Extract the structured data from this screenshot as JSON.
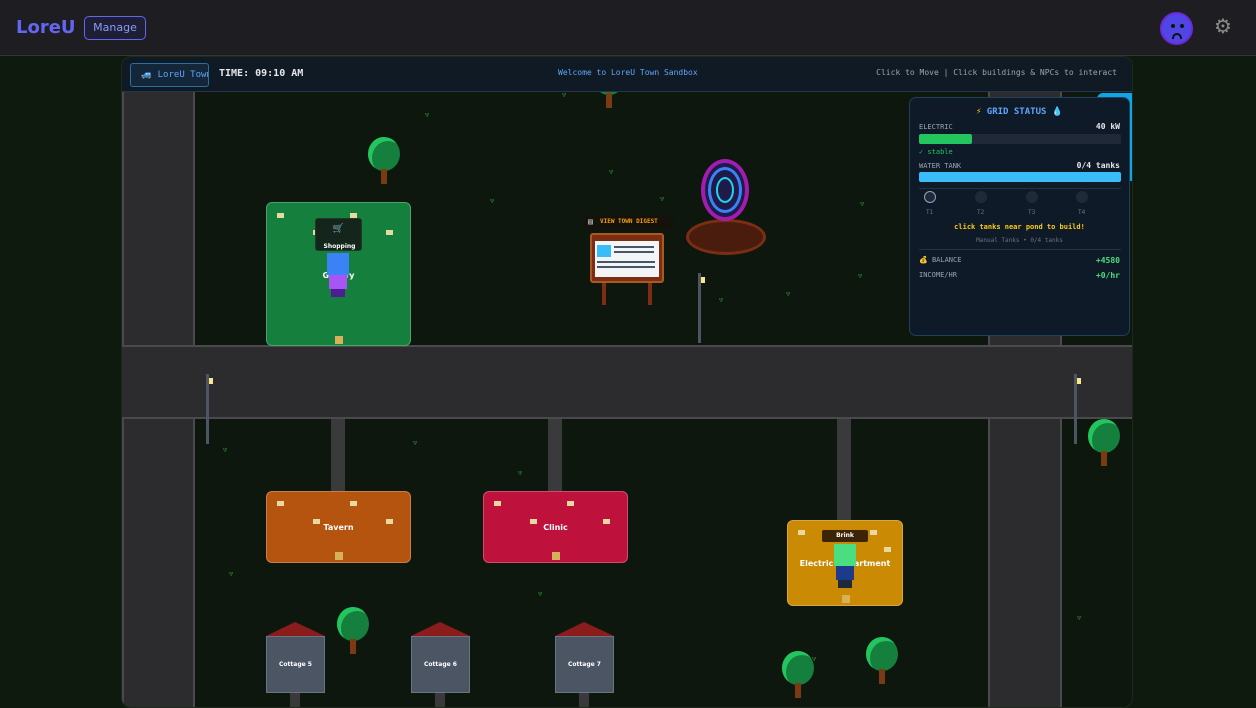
{
  "app": {
    "brand": "LoreU",
    "manage_label": "Manage",
    "avatar_icon": "sad-face-avatar",
    "settings_icon": "gear-icon"
  },
  "hud": {
    "location_label": "LoreU Town",
    "time_label": "TIME: 09:10 AM",
    "welcome": "Welcome to LoreU Town Sandbox",
    "help": "Click to Move | Click buildings & NPCs to interact"
  },
  "map": {
    "buildings": {
      "shopping": "Shopping",
      "gallery": "Gallery",
      "tavern": "Tavern",
      "clinic": "Clinic",
      "electric": "Electric Department"
    },
    "cottages": [
      "Cottage 5",
      "Cottage 6",
      "Cottage 7"
    ],
    "digest_label": "VIEW TOWN DIGEST",
    "npc_tag_shop": "Shopping",
    "npc_tag_brink": "Brink"
  },
  "grid": {
    "title": "GRID STATUS",
    "electric_label": "ELECTRIC",
    "electric_value": "40 kW",
    "electric_fill": 0.26,
    "electric_status": "✓ stable",
    "water_label": "WATER TANK",
    "water_value": "0/4 tanks",
    "water_fill": 1.0,
    "tanks": [
      "T1",
      "T2",
      "T3",
      "T4"
    ],
    "tip": "click tanks near pond to build!",
    "sub": "Manual Tanks • 0/4 tanks",
    "balance_label": "BALANCE",
    "balance_value": "+4580",
    "income_label": "INCOME/HR",
    "income_value": "+0/hr"
  },
  "colors": {
    "brand": "#6366f1",
    "green_building": "#15803d",
    "tavern": "#b4540e",
    "clinic": "#be123c",
    "electric": "#ca8a04",
    "electric_bar": "#22c55e",
    "water_bar": "#38bdf8"
  }
}
